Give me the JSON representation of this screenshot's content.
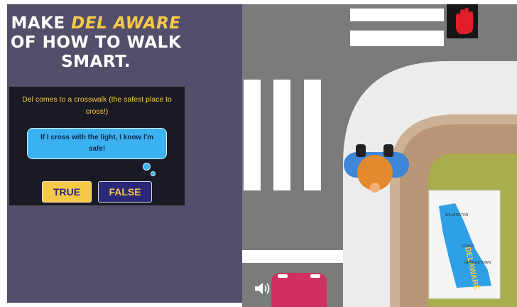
{
  "headline": {
    "line1_prefix": "MAKE",
    "line1_accent": "DEL AWARE",
    "line2": "OF HOW TO WALK",
    "line3": "SMART."
  },
  "quiz": {
    "prompt": "Del comes to a crosswalk (the safest place to cross!)",
    "statement": "If I cross with the light, I know I'm safe!",
    "true_label": "TRUE",
    "false_label": "FALSE"
  },
  "map": {
    "state_name": "DELAWARE",
    "cities": [
      "WILMINGTON",
      "DOVER",
      "GEORGETOWN"
    ]
  },
  "icons": {
    "signal": "stop-hand-icon",
    "sound": "speaker-icon"
  },
  "colors": {
    "accent_yellow": "#f7c948",
    "panel_purple": "#534f6a",
    "button_navy": "#2b2877",
    "bubble_blue": "#3bb1f0",
    "signal_red": "#e11d2a"
  }
}
